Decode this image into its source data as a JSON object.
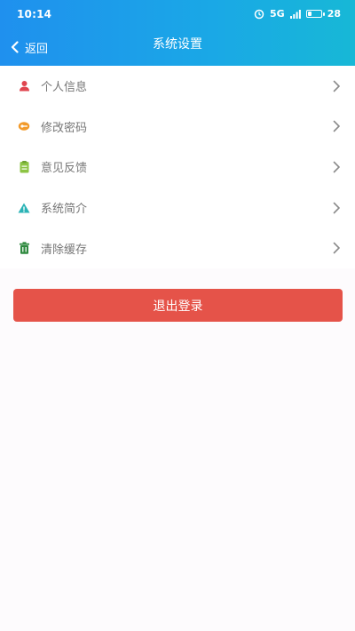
{
  "status_bar": {
    "time": "10:14",
    "signal": "5G",
    "battery": "28",
    "battery_level": 0.28
  },
  "nav": {
    "back_label": "返回",
    "title": "系统设置"
  },
  "items": [
    {
      "label": "个人信息",
      "icon": "person-icon",
      "color": "#e0454f"
    },
    {
      "label": "修改密码",
      "icon": "key-icon",
      "color": "#f29a2a"
    },
    {
      "label": "意见反馈",
      "icon": "feedback-icon",
      "color": "#8dc444"
    },
    {
      "label": "系统简介",
      "icon": "info-triangle-icon",
      "color": "#2bb3b6"
    },
    {
      "label": "清除缓存",
      "icon": "trash-icon",
      "color": "#2f8a3f"
    }
  ],
  "logout_label": "退出登录",
  "colors": {
    "header_gradient": [
      "#1f90ee",
      "#17b8d6"
    ],
    "logout": "#e55349"
  }
}
